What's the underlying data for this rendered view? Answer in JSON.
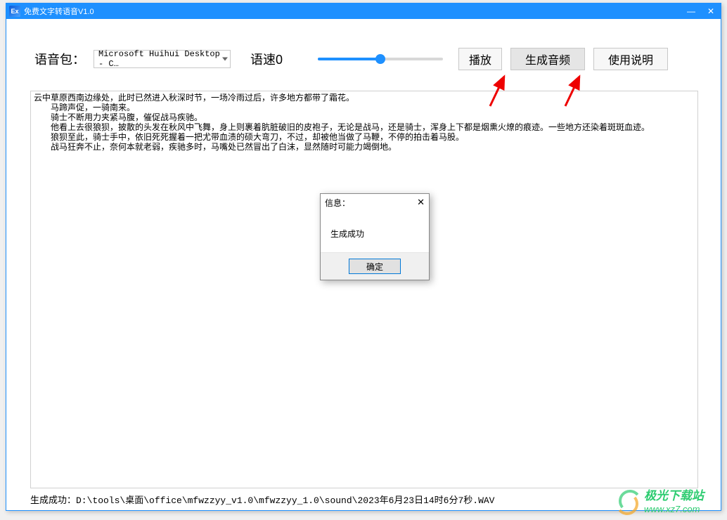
{
  "titlebar": {
    "icon_text": "Ex",
    "title": "免费文字转语音V1.0"
  },
  "toolbar": {
    "voice_label": "语音包：",
    "voice_value": "Microsoft Huihui Desktop - C…",
    "speed_label": "语速0",
    "slider_percent": 50,
    "play_label": "播放",
    "gen_label": "生成音频",
    "help_label": "使用说明"
  },
  "textarea": {
    "content": "云中草原西南边缘处，此时已然进入秋深时节，一场冷雨过后，许多地方都带了霜花。\n　　马蹄声促，一骑南来。\n　　骑士不断用力夹紧马腹，催促战马疾驰。\n　　他看上去很狼狈，披散的头发在秋风中飞舞，身上则裹着肮脏破旧的皮袍子，无论是战马，还是骑士，浑身上下都是烟熏火燎的痕迹。一些地方还染着斑斑血迹。\n　　狼狈至此，骑士手中，依旧死死握着一把尤带血渍的硕大弯刀，不过，却被他当做了马鞭，不停的拍击着马股。\n　　战马狂奔不止，奈何本就老弱，疾驰多时，马嘴处已然冒出了白沫，显然随时可能力竭倒地。"
  },
  "dialog": {
    "title": "信息：",
    "message": "生成成功",
    "ok_label": "确定"
  },
  "statusbar": {
    "text": "生成成功：D:\\tools\\桌面\\office\\mfwzzyy_v1.0\\mfwzzyy_1.0\\sound\\2023年6月23日14时6分7秒.WAV"
  },
  "watermark": {
    "line1": "极光下载站",
    "line2": "www.xz7.com"
  }
}
